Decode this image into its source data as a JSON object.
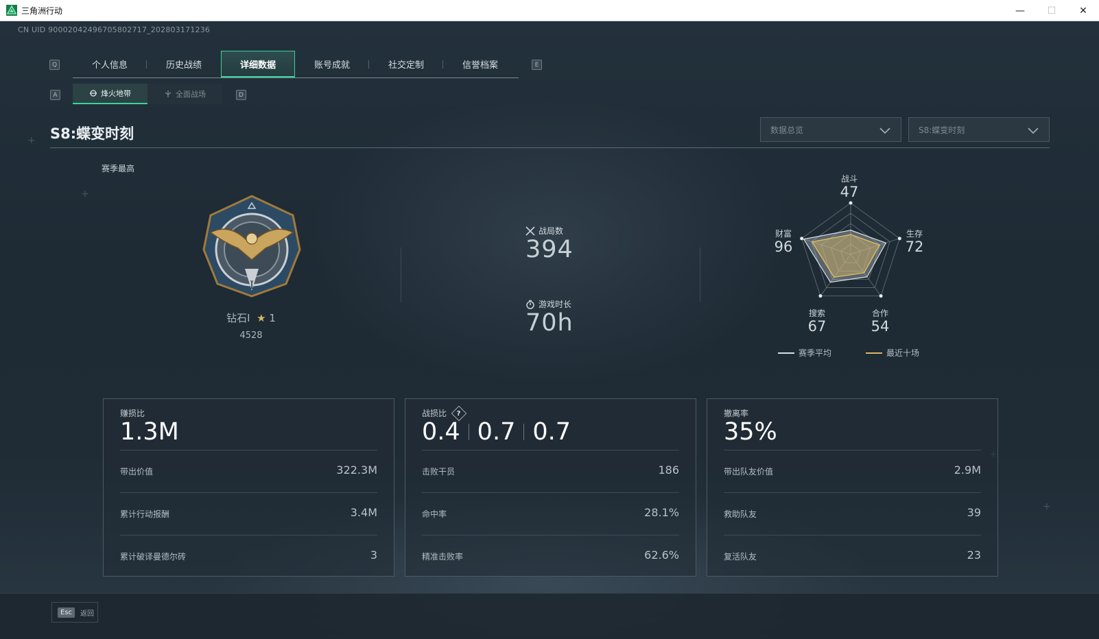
{
  "window": {
    "title": "三角洲行动",
    "minimize": "—",
    "maximize": "☐",
    "close": "✕"
  },
  "uid": "CN UID 9000204249670580271​7_202803171236",
  "keys": {
    "prev_tab": "Q",
    "next_tab": "E",
    "prev_sub": "A",
    "next_sub": "D"
  },
  "tabs": [
    {
      "label": "个人信息"
    },
    {
      "label": "历史战绩"
    },
    {
      "label": "详细数据",
      "active": true
    },
    {
      "label": "账号成就"
    },
    {
      "label": "社交定制"
    },
    {
      "label": "信誉档案"
    }
  ],
  "subtabs": [
    {
      "label": "烽火地带",
      "active": true
    },
    {
      "label": "全面战场"
    }
  ],
  "season": {
    "title": "S8:蝶变时刻"
  },
  "dropdowns": {
    "view": "数据总览",
    "season": "S8:蝶变时刻"
  },
  "rank": {
    "section_label": "赛季最高",
    "name": "钻石I",
    "star_icon": "★",
    "stars": "1",
    "score": "4528"
  },
  "stats": {
    "matches_label": "战局数",
    "matches_value": "394",
    "playtime_label": "游戏时长",
    "playtime_value": "70h"
  },
  "radar": {
    "axes": [
      {
        "label": "战斗",
        "value": "47"
      },
      {
        "label": "生存",
        "value": "72"
      },
      {
        "label": "合作",
        "value": "54"
      },
      {
        "label": "搜索",
        "value": "67"
      },
      {
        "label": "财富",
        "value": "96"
      }
    ],
    "legend": {
      "season_avg": "赛季平均",
      "recent_ten": "最近十场"
    },
    "colors": {
      "season_avg": "#d9e0e4",
      "recent_ten": "#d8b864"
    }
  },
  "cards": [
    {
      "head_label": "赚损比",
      "big": [
        "1.3M"
      ],
      "rows": [
        {
          "label": "带出价值",
          "value": "322.3M"
        },
        {
          "label": "累计行动报酬",
          "value": "3.4M"
        },
        {
          "label": "累计破译曼德尔砖",
          "value": "3"
        }
      ]
    },
    {
      "head_label": "战损比",
      "help": "?",
      "big": [
        "0.4",
        "0.7",
        "0.7"
      ],
      "rows": [
        {
          "label": "击败干员",
          "value": "186"
        },
        {
          "label": "命中率",
          "value": "28.1%"
        },
        {
          "label": "精准击败率",
          "value": "62.6%"
        }
      ]
    },
    {
      "head_label": "撤离率",
      "big": [
        "35%"
      ],
      "rows": [
        {
          "label": "带出队友价值",
          "value": "2.9M"
        },
        {
          "label": "救助队友",
          "value": "39"
        },
        {
          "label": "复活队友",
          "value": "23"
        }
      ]
    }
  ],
  "footer": {
    "esc_key": "Esc",
    "back_label": "返回"
  },
  "accent": "#3cd39a"
}
